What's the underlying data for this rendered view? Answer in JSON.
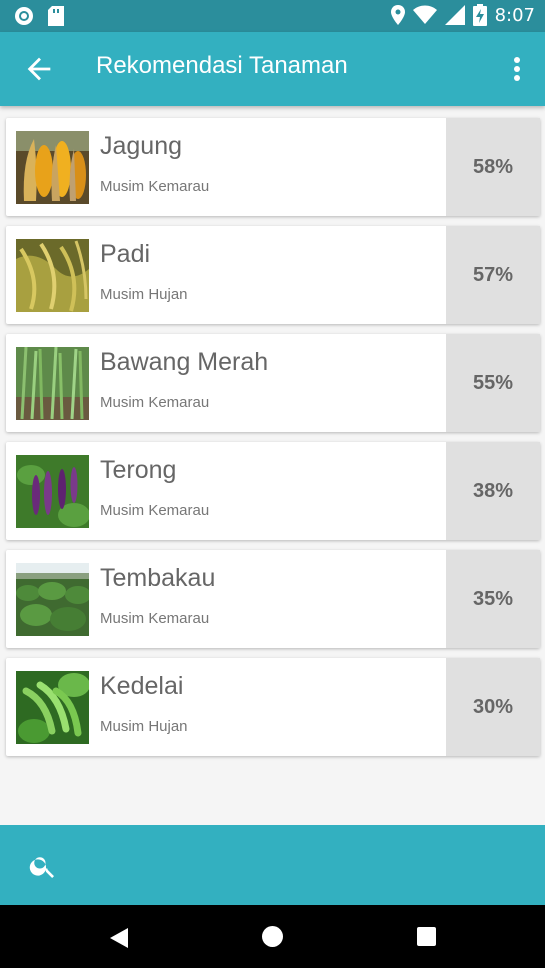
{
  "status_bar": {
    "time": "8:07",
    "left_icons": [
      "record-icon",
      "sd-card-icon"
    ],
    "right_icons": [
      "location-icon",
      "wifi-icon",
      "signal-icon",
      "battery-charging-icon"
    ]
  },
  "app_bar": {
    "title": "Rekomendasi Tanaman",
    "back_icon": "arrow-back-icon",
    "menu_icon": "more-vert-icon"
  },
  "crops": [
    {
      "name": "Jagung",
      "season": "Musim Kemarau",
      "percent": "58%",
      "image": "corn"
    },
    {
      "name": "Padi",
      "season": "Musim Hujan",
      "percent": "57%",
      "image": "rice"
    },
    {
      "name": "Bawang Merah",
      "season": "Musim Kemarau",
      "percent": "55%",
      "image": "shallot"
    },
    {
      "name": "Terong",
      "season": "Musim Kemarau",
      "percent": "38%",
      "image": "eggplant"
    },
    {
      "name": "Tembakau",
      "season": "Musim Kemarau",
      "percent": "35%",
      "image": "tobacco"
    },
    {
      "name": "Kedelai",
      "season": "Musim Hujan",
      "percent": "30%",
      "image": "soybean"
    }
  ],
  "bottom_bar": {
    "search_icon": "search-icon"
  },
  "colors": {
    "primary": "#33b0c0",
    "primary_dark": "#2b8e9c",
    "percent_bg": "#e0e0e0",
    "text": "#666666"
  }
}
